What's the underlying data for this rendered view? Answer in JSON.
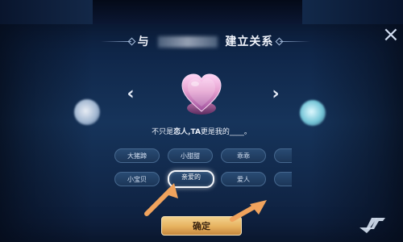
{
  "dialog": {
    "title_prefix": "与",
    "title_suffix": "建立关系",
    "status_line_prefix": "不只是",
    "status_line_emphasis_1": "恋人,TA",
    "status_line_middle": "更是我的",
    "status_line_blank": "____。"
  },
  "tags": [
    {
      "label": "大猪蹄",
      "selected": false
    },
    {
      "label": "小甜甜",
      "selected": false
    },
    {
      "label": "乖乖",
      "selected": false
    },
    {
      "label": "",
      "selected": false
    },
    {
      "label": "小宝贝",
      "selected": false
    },
    {
      "label": "亲爱的",
      "selected": true
    },
    {
      "label": "爱人",
      "selected": false
    },
    {
      "label": "",
      "selected": false
    }
  ],
  "buttons": {
    "confirm_label": "确定"
  },
  "icons": {
    "close": "close-icon",
    "prev": "chevron-left-icon",
    "next": "chevron-right-icon",
    "heart": "heart-icon",
    "watermark": "watermark-icon"
  },
  "colors": {
    "background": "#0d2142",
    "accent_gold": "#e6b15e",
    "tag_bg": "#294b73",
    "selected_tag_border": "#f4f7fb",
    "pointer_orange": "#f0a35d",
    "heart_pink": "#e6a1d0"
  }
}
